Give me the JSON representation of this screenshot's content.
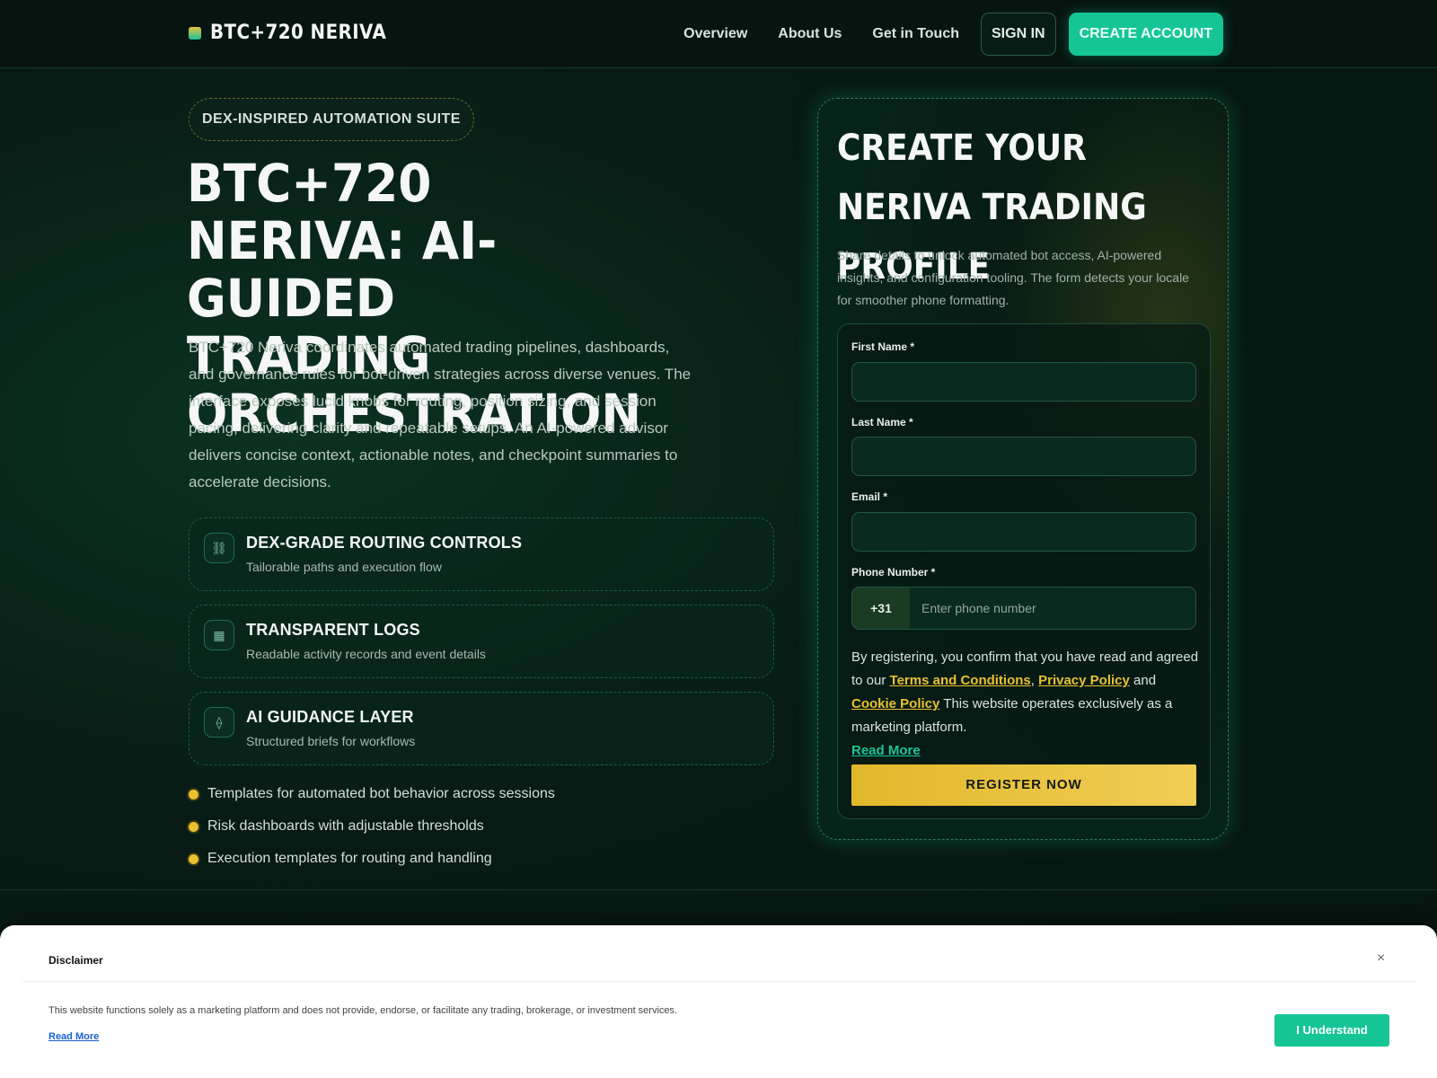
{
  "header": {
    "brand": "BTC+720 NERIVA",
    "nav": [
      "Overview",
      "About Us",
      "Get in Touch"
    ],
    "sign_in": "SIGN IN",
    "create_account": "CREATE ACCOUNT"
  },
  "hero": {
    "badge": "DEX-INSPIRED AUTOMATION SUITE",
    "title": "BTC+720 NERIVA: AI-GUIDED TRADING ORCHESTRATION",
    "description": "BTC+720 Neriva coordinates automated trading pipelines, dashboards, and governance rules for bot-driven strategies across diverse venues. The interface exposes lucid knobs for routing, position sizing, and session pacing, delivering clarity and repeatable setups. An AI-powered advisor delivers concise context, actionable notes, and checkpoint summaries to accelerate decisions.",
    "features": [
      {
        "icon": "routing-icon",
        "glyph": "⛓",
        "title": "DEX-GRADE ROUTING CONTROLS",
        "subtitle": "Tailorable paths and execution flow"
      },
      {
        "icon": "logs-icon",
        "glyph": "▦",
        "title": "TRANSPARENT LOGS",
        "subtitle": "Readable activity records and event details"
      },
      {
        "icon": "ai-icon",
        "glyph": "⟠",
        "title": "AI GUIDANCE LAYER",
        "subtitle": "Structured briefs for workflows"
      }
    ],
    "bullets": [
      "Templates for automated bot behavior across sessions",
      "Risk dashboards with adjustable thresholds",
      "Execution templates for routing and handling"
    ]
  },
  "form": {
    "title": "CREATE YOUR NERIVA TRADING PROFILE",
    "subtitle": "Share details to unlock automated bot access, AI-powered insights, and configuration tooling. The form detects your locale for smoother phone formatting.",
    "first_name_label": "First Name *",
    "last_name_label": "Last Name *",
    "email_label": "Email *",
    "phone_label": "Phone Number *",
    "phone_code": "+31",
    "phone_placeholder": "Enter phone number",
    "consent_prefix": "By registering, you confirm that you have read and agreed to our",
    "terms": "Terms and Conditions",
    "privacy": "Privacy Policy",
    "and": "and",
    "cookie": "Cookie Policy",
    "marketing_note": "This website operates exclusively as a marketing platform.",
    "read_more": "Read More",
    "register": "REGISTER NOW"
  },
  "disclaimer": {
    "title": "Disclaimer",
    "close": "×",
    "text": "This website functions solely as a marketing platform and does not provide, endorse, or facilitate any trading, brokerage, or investment services.",
    "read_more": "Read More",
    "button": "I Understand"
  },
  "colors": {
    "accent_teal": "#16c596",
    "accent_gold": "#e9c02f",
    "background": "#071a14"
  }
}
